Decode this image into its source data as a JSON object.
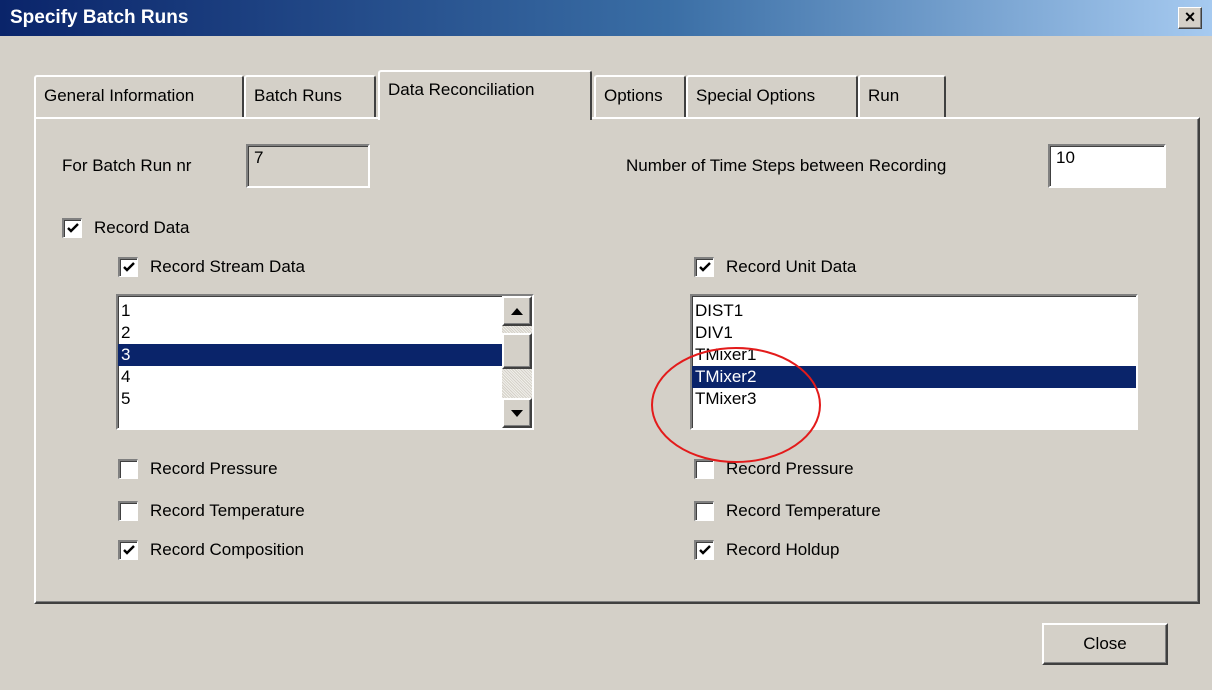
{
  "window": {
    "title": "Specify Batch Runs",
    "close_glyph": "×"
  },
  "tabs": [
    {
      "label": "General Information"
    },
    {
      "label": "Batch Runs"
    },
    {
      "label": "Data Reconciliation",
      "active": true
    },
    {
      "label": "Options"
    },
    {
      "label": "Special Options"
    },
    {
      "label": "Run"
    }
  ],
  "batch_run": {
    "label": "For Batch Run nr",
    "value": "7"
  },
  "time_steps": {
    "label": "Number of Time Steps between Recording",
    "value": "10"
  },
  "record_data": {
    "label": "Record Data",
    "checked": true
  },
  "stream": {
    "record_label": "Record Stream Data",
    "record_checked": true,
    "items": [
      "1",
      "2",
      "3",
      "4",
      "5"
    ],
    "selected": "3",
    "scroll_position": 0.2,
    "pressure_label": "Record Pressure",
    "pressure_checked": false,
    "temperature_label": "Record Temperature",
    "temperature_checked": false,
    "composition_label": "Record Composition",
    "composition_checked": true
  },
  "unit": {
    "record_label": "Record Unit Data",
    "record_checked": true,
    "items": [
      "DIST1",
      "DIV1",
      "TMixer1",
      "TMixer2",
      "TMixer3"
    ],
    "selected": "TMixer2",
    "pressure_label": "Record Pressure",
    "pressure_checked": false,
    "temperature_label": "Record Temperature",
    "temperature_checked": false,
    "holdup_label": "Record Holdup",
    "holdup_checked": true
  },
  "close_button": {
    "label": "Close"
  },
  "colors": {
    "titlebar": "#0a246a",
    "highlight": "#0a246a",
    "annotation": "#e31b1b",
    "face": "#d4d0c8"
  }
}
